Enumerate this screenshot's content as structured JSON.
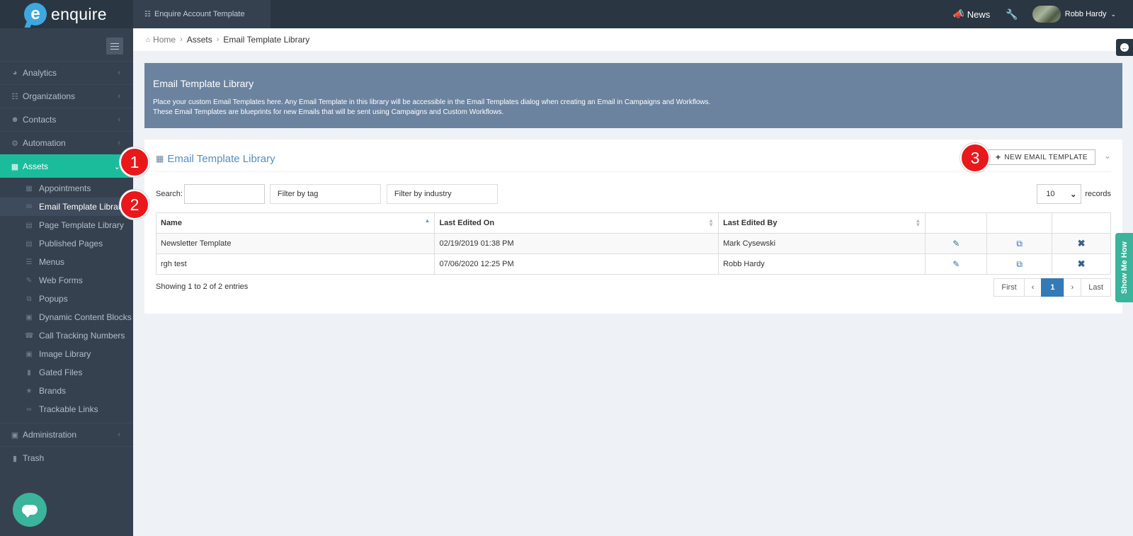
{
  "header": {
    "logo_text": "enquire",
    "logo_letter": "e",
    "account_name": "Enquire Account Template",
    "news_label": "News",
    "user_name": "Robb Hardy"
  },
  "sidebar": {
    "items": [
      {
        "label": "Analytics",
        "icon": "dashboard-icon"
      },
      {
        "label": "Organizations",
        "icon": "sitemap-icon"
      },
      {
        "label": "Contacts",
        "icon": "users-icon"
      },
      {
        "label": "Automation",
        "icon": "cogs-icon"
      },
      {
        "label": "Assets",
        "icon": "grid-icon",
        "active": true
      }
    ],
    "sub_items": [
      {
        "label": "Appointments",
        "icon": "calendar-icon"
      },
      {
        "label": "Email Template Library",
        "icon": "envelope-icon",
        "active": true
      },
      {
        "label": "Page Template Library",
        "icon": "page-template-icon"
      },
      {
        "label": "Published Pages",
        "icon": "published-icon"
      },
      {
        "label": "Menus",
        "icon": "menu-icon"
      },
      {
        "label": "Web Forms",
        "icon": "edit-icon"
      },
      {
        "label": "Popups",
        "icon": "popup-icon"
      },
      {
        "label": "Dynamic Content Blocks",
        "icon": "blocks-icon"
      },
      {
        "label": "Call Tracking Numbers",
        "icon": "phone-icon"
      },
      {
        "label": "Image Library",
        "icon": "image-icon"
      },
      {
        "label": "Gated Files",
        "icon": "file-icon"
      },
      {
        "label": "Brands",
        "icon": "star-icon"
      },
      {
        "label": "Trackable Links",
        "icon": "link-icon"
      }
    ],
    "bottom_items": [
      {
        "label": "Administration",
        "icon": "lock-icon"
      },
      {
        "label": "Trash",
        "icon": "trash-icon"
      }
    ]
  },
  "breadcrumb": [
    "Home",
    "Assets",
    "Email Template Library"
  ],
  "banner": {
    "title": "Email Template Library",
    "line1": "Place your custom Email Templates here. Any Email Template in this library will be accessible in the Email Templates dialog when creating an Email in Campaigns and Workflows.",
    "line2": "These Email Templates are blueprints for new Emails that will be sent using Campaigns and Custom Workflows."
  },
  "portlet": {
    "title": "Email Template Library",
    "new_button": "NEW EMAIL TEMPLATE",
    "search_label": "Search:",
    "search_value": "",
    "filter_tag": "Filter by tag",
    "filter_industry": "Filter by industry",
    "records_value": "10",
    "records_label": "records"
  },
  "table": {
    "columns": [
      "Name",
      "Last Edited On",
      "Last Edited By"
    ],
    "rows": [
      {
        "name": "Newsletter Template",
        "edited_on": "02/19/2019 01:38 PM",
        "edited_by": "Mark Cysewski"
      },
      {
        "name": "rgh test",
        "edited_on": "07/06/2020 12:25 PM",
        "edited_by": "Robb Hardy"
      }
    ]
  },
  "footer": {
    "info": "Showing 1 to 2 of 2 entries",
    "pager": {
      "first": "First",
      "prev": "‹",
      "current": "1",
      "next": "›",
      "last": "Last"
    }
  },
  "callouts": [
    "1",
    "2",
    "3"
  ],
  "show_me_how": "Show Me How",
  "colors": {
    "topbar": "#2b3643",
    "sidebar": "#364150",
    "active": "#1bbc9b",
    "banner": "#6b839f",
    "title": "#578ebe",
    "callout": "#e8181b"
  }
}
